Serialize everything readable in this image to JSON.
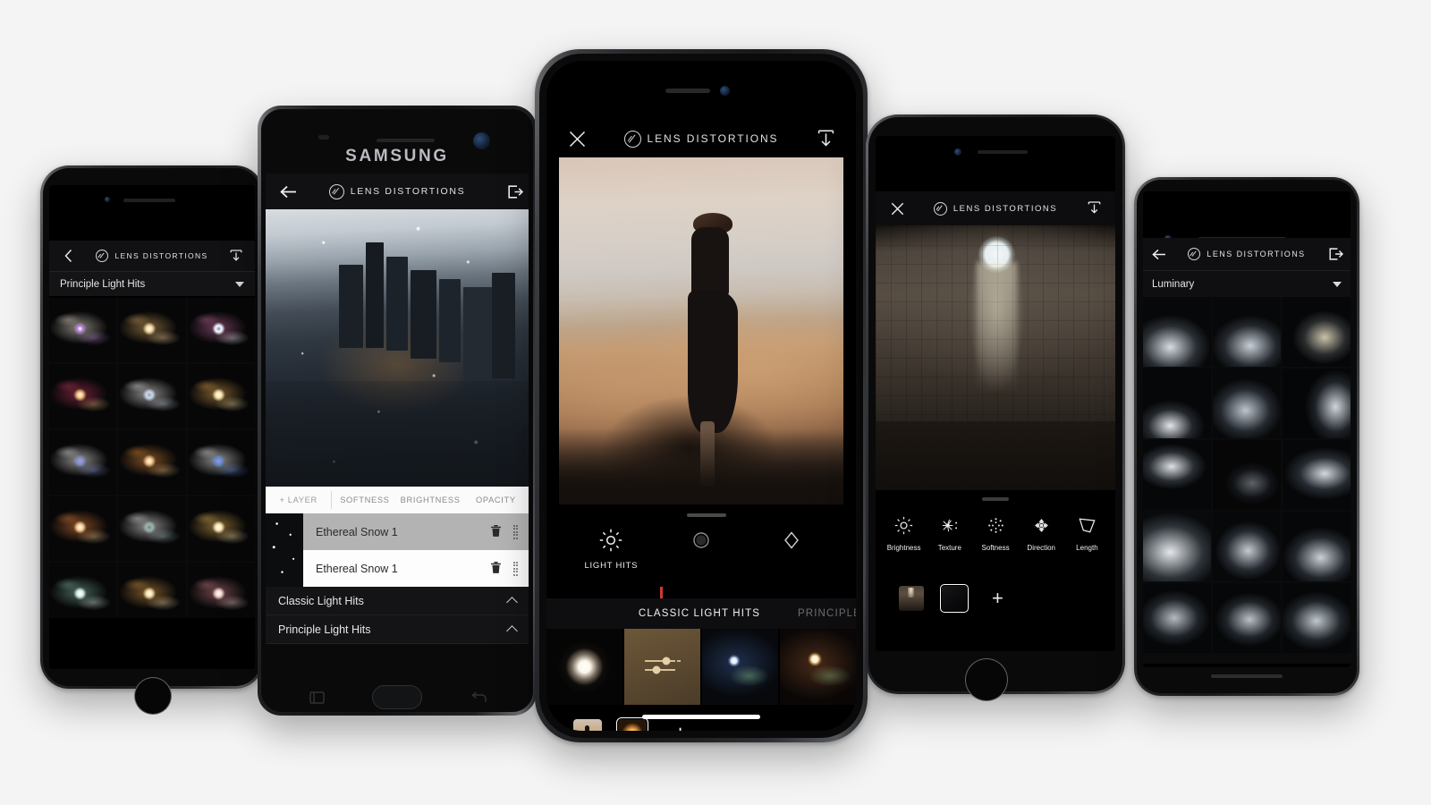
{
  "page": {
    "background": "#f4f4f4",
    "brand_name": "LENS DISTORTIONS",
    "accent_red": "#cf3a2e"
  },
  "phones": {
    "left": {
      "device": "iPhone (space gray)",
      "appbar": {
        "back_icon": "chevron-left-icon",
        "brand": "LENS DISTORTIONS",
        "export_icon": "export-download-icon"
      },
      "collection": {
        "label": "Principle Light Hits",
        "caret_icon": "chevron-down-icon"
      },
      "grid": {
        "columns": 3,
        "thumbnails": [
          {
            "name": "flare-violet-burst",
            "colors": [
              "#efe6d6",
              "#b07ed0",
              "#ffffff"
            ]
          },
          {
            "name": "flare-amber-haze",
            "colors": [
              "#d9a85f",
              "#f4d7a0",
              "#ffffff"
            ]
          },
          {
            "name": "flare-magenta-star",
            "colors": [
              "#c06a9e",
              "#ffffff",
              "#6e8fd6"
            ]
          },
          {
            "name": "flare-crimson-streak",
            "colors": [
              "#c0395c",
              "#f0c07a",
              "#ffffff"
            ]
          },
          {
            "name": "flare-white-starburst",
            "colors": [
              "#ffffff",
              "#cfd8e8",
              "#8fa8c8"
            ]
          },
          {
            "name": "flare-gold-starburst",
            "colors": [
              "#e0a84f",
              "#f7e2ae",
              "#ffffff"
            ]
          },
          {
            "name": "flare-blue-bloom",
            "colors": [
              "#ffffff",
              "#7f8fd0",
              "#b0a0c8"
            ]
          },
          {
            "name": "flare-orange-bloom",
            "colors": [
              "#e08c3c",
              "#f3c487",
              "#ffffff"
            ]
          },
          {
            "name": "flare-cyan-spike",
            "colors": [
              "#ffffff",
              "#5f8ed8",
              "#c08ad0"
            ]
          },
          {
            "name": "flare-sunset-spike",
            "colors": [
              "#e8823c",
              "#f5cf96",
              "#ffffff"
            ]
          },
          {
            "name": "flare-cool-spike",
            "colors": [
              "#ffffff",
              "#9fb4b0",
              "#6f8a80"
            ]
          },
          {
            "name": "flare-honey-spike",
            "colors": [
              "#eab757",
              "#fbe6b6",
              "#ffffff"
            ]
          },
          {
            "name": "flare-teal-edge",
            "colors": [
              "#7fb3a0",
              "#dff0e4",
              "#ffffff"
            ]
          },
          {
            "name": "flare-amber-edge",
            "colors": [
              "#d99a46",
              "#f6dfae",
              "#ffffff"
            ]
          },
          {
            "name": "flare-rose-edge",
            "colors": [
              "#c97c86",
              "#f2d6d0",
              "#ffffff"
            ]
          }
        ]
      },
      "home_button": "home-button"
    },
    "samsung": {
      "device": "SAMSUNG",
      "brand_logo": "SAMSUNG",
      "appbar": {
        "back_icon": "arrow-left-icon",
        "brand": "LENS DISTORTIONS",
        "export_icon": "export-arrow-icon"
      },
      "photo": {
        "name": "aerial-city-snow-photo",
        "description": "Aerial downtown skyline with falling snow"
      },
      "layer_toolbar": {
        "items": [
          "+ LAYER",
          "SOFTNESS",
          "BRIGHTNESS",
          "OPACITY"
        ]
      },
      "layers": [
        {
          "name": "Ethereal Snow 1",
          "active": true,
          "delete_icon": "trash-icon",
          "drag_icon": "drag-handle-icon"
        },
        {
          "name": "Ethereal Snow 1",
          "active": false,
          "delete_icon": "trash-icon",
          "drag_icon": "drag-handle-icon"
        }
      ],
      "sections": [
        {
          "name": "Classic Light Hits",
          "chevron": "chevron-up-icon"
        },
        {
          "name": "Principle Light Hits",
          "chevron": "chevron-up-icon"
        }
      ],
      "nav": {
        "recents_icon": "recents-icon",
        "home_icon": "home-button",
        "back_icon": "back-icon"
      }
    },
    "center": {
      "device": "iPhone X (hero)",
      "appbar": {
        "close_icon": "close-x-icon",
        "brand": "LENS DISTORTIONS",
        "export_icon": "export-download-icon"
      },
      "photo": {
        "name": "woman-on-ridge-photo",
        "description": "Woman in black dress standing on golden hillside at sunset"
      },
      "tools": [
        {
          "label": "LIGHT HITS",
          "icon": "sun-rays-icon",
          "active": true
        },
        {
          "label": "",
          "icon": "filled-circle-icon",
          "active": false
        },
        {
          "label": "",
          "icon": "diamond-outline-icon",
          "active": false
        }
      ],
      "categories": [
        {
          "label": "CLASSIC LIGHT HITS",
          "active": true
        },
        {
          "label": "PRINCIPLE",
          "active": false
        }
      ],
      "presets": [
        {
          "name": "soft-white-glow",
          "selected": false
        },
        {
          "name": "sliders-adjust-tile",
          "selected": true,
          "icon": "sliders-icon"
        },
        {
          "name": "blue-lens-flare",
          "selected": false
        },
        {
          "name": "golden-lens-flare",
          "selected": false
        }
      ],
      "filmstrip": [
        {
          "name": "original-photo-chip",
          "selected": false
        },
        {
          "name": "glow-effect-chip",
          "selected": true
        },
        {
          "name": "add-layer-button",
          "label": "+"
        }
      ],
      "home_indicator": "home-indicator"
    },
    "pantheon": {
      "device": "iPhone (space gray)",
      "appbar": {
        "close_icon": "close-x-icon",
        "brand": "LENS DISTORTIONS",
        "export_icon": "export-download-icon"
      },
      "photo": {
        "name": "pantheon-oculus-photo",
        "description": "Pantheon dome interior with oculus light beam"
      },
      "grabber": "drag-grabber",
      "tools": [
        {
          "label": "Brightness",
          "icon": "sun-rays-icon"
        },
        {
          "label": "Texture",
          "icon": "texture-burst-icon"
        },
        {
          "label": "Softness",
          "icon": "dotted-circle-icon"
        },
        {
          "label": "Direction",
          "icon": "direction-arrows-icon"
        },
        {
          "label": "Length",
          "icon": "length-trapezoid-icon"
        }
      ],
      "filmstrip": [
        {
          "name": "original-photo-chip",
          "selected": false
        },
        {
          "name": "light-ray-chip",
          "selected": true
        },
        {
          "name": "add-layer-button",
          "label": "+"
        }
      ],
      "home_button": "home-button"
    },
    "right": {
      "device": "iPhone (space gray)",
      "appbar": {
        "back_icon": "arrow-left-icon",
        "brand": "LENS DISTORTIONS",
        "export_icon": "export-arrow-icon"
      },
      "collection": {
        "label": "Luminary",
        "caret_icon": "chevron-down-icon"
      },
      "grid": {
        "columns": 3,
        "thumbnails": [
          {
            "name": "luminary-mist-1"
          },
          {
            "name": "luminary-mist-2"
          },
          {
            "name": "luminary-prism-3"
          },
          {
            "name": "luminary-orb-4"
          },
          {
            "name": "luminary-shard-5"
          },
          {
            "name": "luminary-glow-6"
          },
          {
            "name": "luminary-crystal-7"
          },
          {
            "name": "luminary-dark-8"
          },
          {
            "name": "luminary-ring-9"
          },
          {
            "name": "luminary-soft-10"
          },
          {
            "name": "luminary-bokeh-11"
          },
          {
            "name": "luminary-veil-12"
          },
          {
            "name": "luminary-edge-13"
          },
          {
            "name": "luminary-edge-14"
          },
          {
            "name": "luminary-edge-15"
          }
        ]
      }
    }
  }
}
